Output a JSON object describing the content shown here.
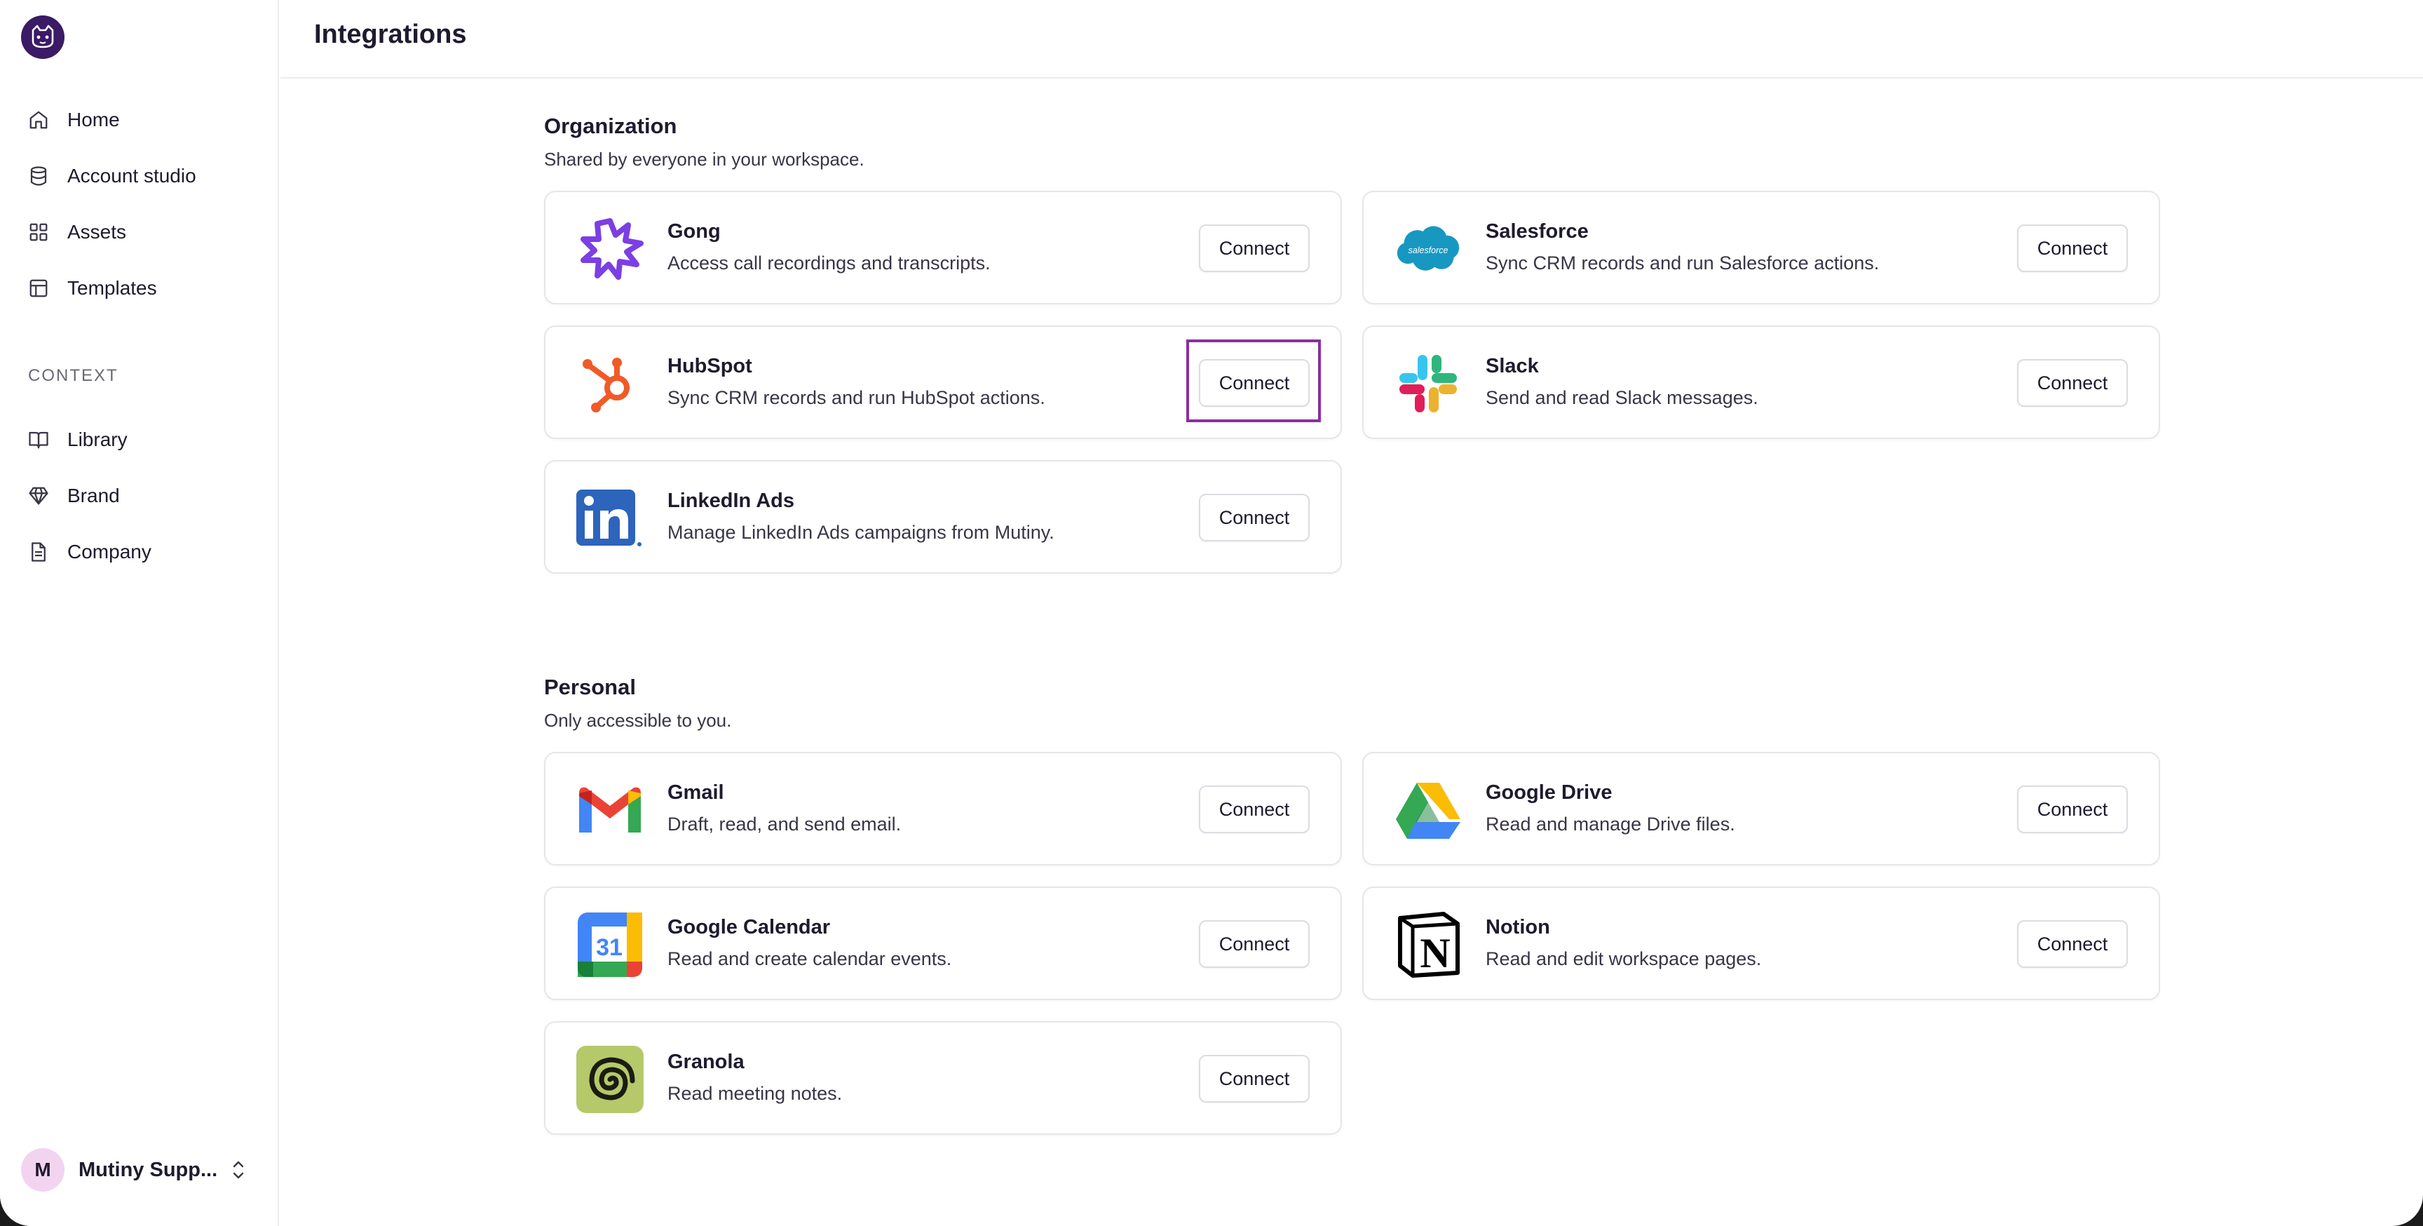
{
  "app": {
    "avatar_initial": "M",
    "user_name": "Mutiny Supp..."
  },
  "sidebar": {
    "items": [
      {
        "label": "Home",
        "icon": "home-icon"
      },
      {
        "label": "Account studio",
        "icon": "database-icon"
      },
      {
        "label": "Assets",
        "icon": "grid-icon"
      },
      {
        "label": "Templates",
        "icon": "layout-icon"
      }
    ],
    "context_label": "CONTEXT",
    "context_items": [
      {
        "label": "Library",
        "icon": "book-icon"
      },
      {
        "label": "Brand",
        "icon": "gem-icon"
      },
      {
        "label": "Company",
        "icon": "document-icon"
      }
    ]
  },
  "header": {
    "title": "Integrations"
  },
  "organization": {
    "title": "Organization",
    "subtitle": "Shared by everyone in your workspace.",
    "cards": [
      {
        "name": "Gong",
        "desc": "Access call recordings and transcripts.",
        "button": "Connect",
        "icon": "gong-logo"
      },
      {
        "name": "Salesforce",
        "desc": "Sync CRM records and run Salesforce actions.",
        "button": "Connect",
        "icon": "salesforce-logo"
      },
      {
        "name": "HubSpot",
        "desc": "Sync CRM records and run HubSpot actions.",
        "button": "Connect",
        "icon": "hubspot-logo"
      },
      {
        "name": "Slack",
        "desc": "Send and read Slack messages.",
        "button": "Connect",
        "icon": "slack-logo"
      },
      {
        "name": "LinkedIn Ads",
        "desc": "Manage LinkedIn Ads campaigns from Mutiny.",
        "button": "Connect",
        "icon": "linkedin-logo"
      }
    ]
  },
  "personal": {
    "title": "Personal",
    "subtitle": "Only accessible to you.",
    "cards": [
      {
        "name": "Gmail",
        "desc": "Draft, read, and send email.",
        "button": "Connect",
        "icon": "gmail-logo"
      },
      {
        "name": "Google Drive",
        "desc": "Read and manage Drive files.",
        "button": "Connect",
        "icon": "google-drive-logo"
      },
      {
        "name": "Google Calendar",
        "desc": "Read and create calendar events.",
        "button": "Connect",
        "icon": "google-calendar-logo",
        "logo_text": "31"
      },
      {
        "name": "Notion",
        "desc": "Read and edit workspace pages.",
        "button": "Connect",
        "icon": "notion-logo",
        "logo_text": "N"
      },
      {
        "name": "Granola",
        "desc": "Read meeting notes.",
        "button": "Connect",
        "icon": "granola-logo"
      }
    ]
  },
  "colors": {
    "brand": "#3b1a66",
    "highlight": "#8a2fa0",
    "border": "#e6e6ea"
  }
}
